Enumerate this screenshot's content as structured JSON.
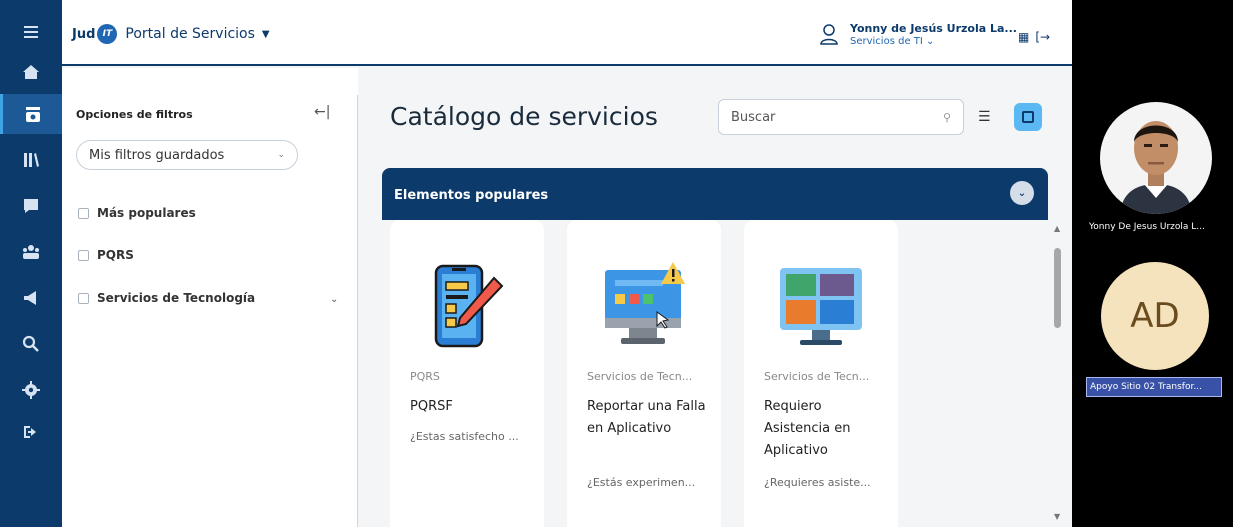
{
  "header": {
    "brand_jud": "Jud",
    "brand_it": "IT",
    "portal_title": "Portal de Servicios",
    "user_name": "Yonny de Jesús Urzola La...",
    "user_role": "Servicios de TI ⌄"
  },
  "leftnav": {
    "icons": [
      "menu-icon",
      "home-icon",
      "catalog-icon",
      "knowledge-icon",
      "chat-icon",
      "group-icon",
      "announcement-icon",
      "search-icon",
      "settings-icon",
      "logout-icon"
    ],
    "active": "catalog-icon"
  },
  "filters": {
    "title": "Opciones de filtros",
    "saved_filters": "Mis filtros guardados",
    "options": [
      "Más populares",
      "PQRS",
      "Servicios de Tecnología"
    ]
  },
  "catalog": {
    "title": "Catálogo de servicios",
    "search_placeholder": "Buscar",
    "section_title": "Elementos populares",
    "cards": [
      {
        "category": "PQRS",
        "name": "PQRSF",
        "description": "¿Estas satisfecho ..."
      },
      {
        "category": "Servicios de Tecn...",
        "name": "Reportar una Falla en Aplicativo",
        "description": "¿Estás experimen..."
      },
      {
        "category": "Servicios de Tecn...",
        "name": "Requiero Asistencia en Aplicativo",
        "description": "¿Requieres asiste..."
      }
    ]
  },
  "participants": [
    {
      "name": "Yonny De Jesus Urzola L..."
    },
    {
      "initials": "AD",
      "name": "Apoyo Sitio 02 Transfor..."
    }
  ],
  "colors": {
    "nav": "#0c3a6b",
    "accent": "#5bb8f2",
    "banner": "#0c3a6b"
  }
}
